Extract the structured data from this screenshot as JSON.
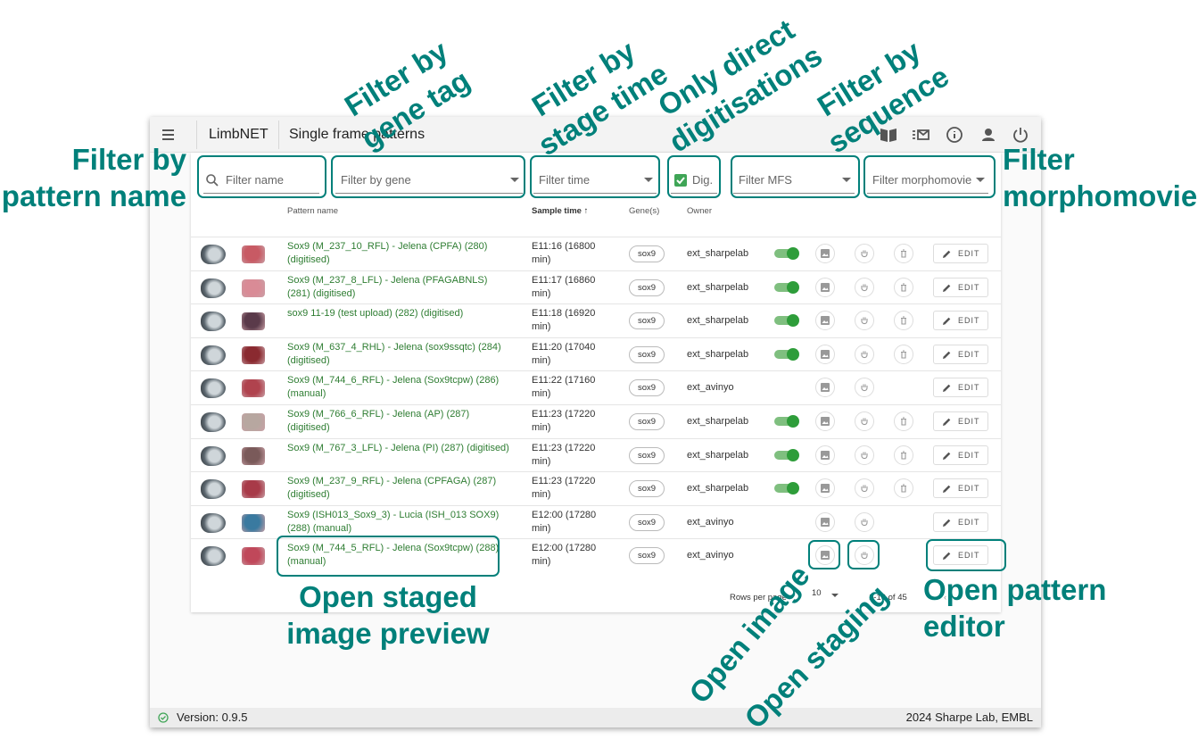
{
  "app": {
    "name": "LimbNET",
    "page_title": "Single frame patterns"
  },
  "toolbar_icons": [
    "book-icon",
    "message-list-icon",
    "info-icon",
    "person-icon",
    "power-icon"
  ],
  "filters": {
    "name": "Filter name",
    "gene": "Filter by gene",
    "time": "Filter time",
    "dig": "Dig.",
    "mfs": "Filter MFS",
    "morphomovie": "Filter morphomovie"
  },
  "table": {
    "headers": {
      "name": "Pattern name",
      "time": "Sample time",
      "genes": "Gene(s)",
      "owner": "Owner"
    },
    "rows": [
      {
        "name": "Sox9 (M_237_10_RFL) - Jelena (CPFA) (280) (digitised)",
        "time": "E11:16 (16800 min)",
        "gene": "sox9",
        "owner": "ext_sharpelab",
        "toggle": true,
        "delete": true,
        "color": "#c85a64"
      },
      {
        "name": "Sox9 (M_237_8_LFL) - Jelena (PFAGABNLS) (281) (digitised)",
        "time": "E11:17 (16860 min)",
        "gene": "sox9",
        "owner": "ext_sharpelab",
        "toggle": true,
        "delete": true,
        "color": "#d98b96"
      },
      {
        "name": "sox9 11-19 (test upload) (282) (digitised)",
        "time": "E11:18 (16920 min)",
        "gene": "sox9",
        "owner": "ext_sharpelab",
        "toggle": true,
        "delete": true,
        "color": "#5a3a4a"
      },
      {
        "name": "Sox9 (M_637_4_RHL) - Jelena (sox9ssqtc) (284) (digitised)",
        "time": "E11:20 (17040 min)",
        "gene": "sox9",
        "owner": "ext_sharpelab",
        "toggle": true,
        "delete": true,
        "color": "#8a2a30"
      },
      {
        "name": "Sox9 (M_744_6_RFL) - Jelena (Sox9tcpw) (286) (manual)",
        "time": "E11:22 (17160 min)",
        "gene": "sox9",
        "owner": "ext_avinyo",
        "toggle": false,
        "delete": false,
        "color": "#b0434e"
      },
      {
        "name": "Sox9 (M_766_6_RFL) - Jelena (AP) (287) (digitised)",
        "time": "E11:23 (17220 min)",
        "gene": "sox9",
        "owner": "ext_sharpelab",
        "toggle": true,
        "delete": true,
        "color": "#b7a7a0"
      },
      {
        "name": "Sox9 (M_767_3_LFL) - Jelena (PI) (287) (digitised)",
        "time": "E11:23 (17220 min)",
        "gene": "sox9",
        "owner": "ext_sharpelab",
        "toggle": true,
        "delete": true,
        "color": "#7a5a5a"
      },
      {
        "name": "Sox9 (M_237_9_RFL) - Jelena (CPFAGA) (287) (digitised)",
        "time": "E11:23 (17220 min)",
        "gene": "sox9",
        "owner": "ext_sharpelab",
        "toggle": true,
        "delete": true,
        "color": "#a83a48"
      },
      {
        "name": "Sox9 (ISH013_Sox9_3) - Lucia (ISH_013 SOX9) (288) (manual)",
        "time": "E12:00 (17280 min)",
        "gene": "sox9",
        "owner": "ext_avinyo",
        "toggle": false,
        "delete": false,
        "color": "#3a7aa0"
      },
      {
        "name": "Sox9 (M_744_5_RFL) - Jelena (Sox9tcpw) (288) (manual)",
        "time": "E12:00 (17280 min)",
        "gene": "sox9",
        "owner": "ext_avinyo",
        "toggle": false,
        "delete": false,
        "color": "#c0485a"
      }
    ],
    "edit_label": "EDIT"
  },
  "pagination": {
    "rows_per_page_label": "Rows per page",
    "rows_per_page": "10",
    "range": "1-10 of 45"
  },
  "footer": {
    "version": "Version: 0.9.5",
    "copyright": "2024 Sharpe Lab, EMBL"
  },
  "annotations": {
    "filter_name": [
      "Filter by",
      "pattern name"
    ],
    "filter_gene": [
      "Filter by",
      "gene tag"
    ],
    "filter_time": [
      "Filter by",
      "stage time"
    ],
    "only_direct": [
      "Only direct",
      "digitisations"
    ],
    "filter_seq": [
      "Filter by",
      "sequence"
    ],
    "filter_movie": [
      "Filter",
      "morphomovie"
    ],
    "open_preview": [
      "Open staged",
      "image preview"
    ],
    "open_image": "Open image",
    "open_staging": "Open staging",
    "open_editor": [
      "Open pattern",
      "editor"
    ]
  },
  "colors": {
    "accent": "#00807a",
    "link": "#2e7d32",
    "toggle": "#2e9d3a"
  }
}
